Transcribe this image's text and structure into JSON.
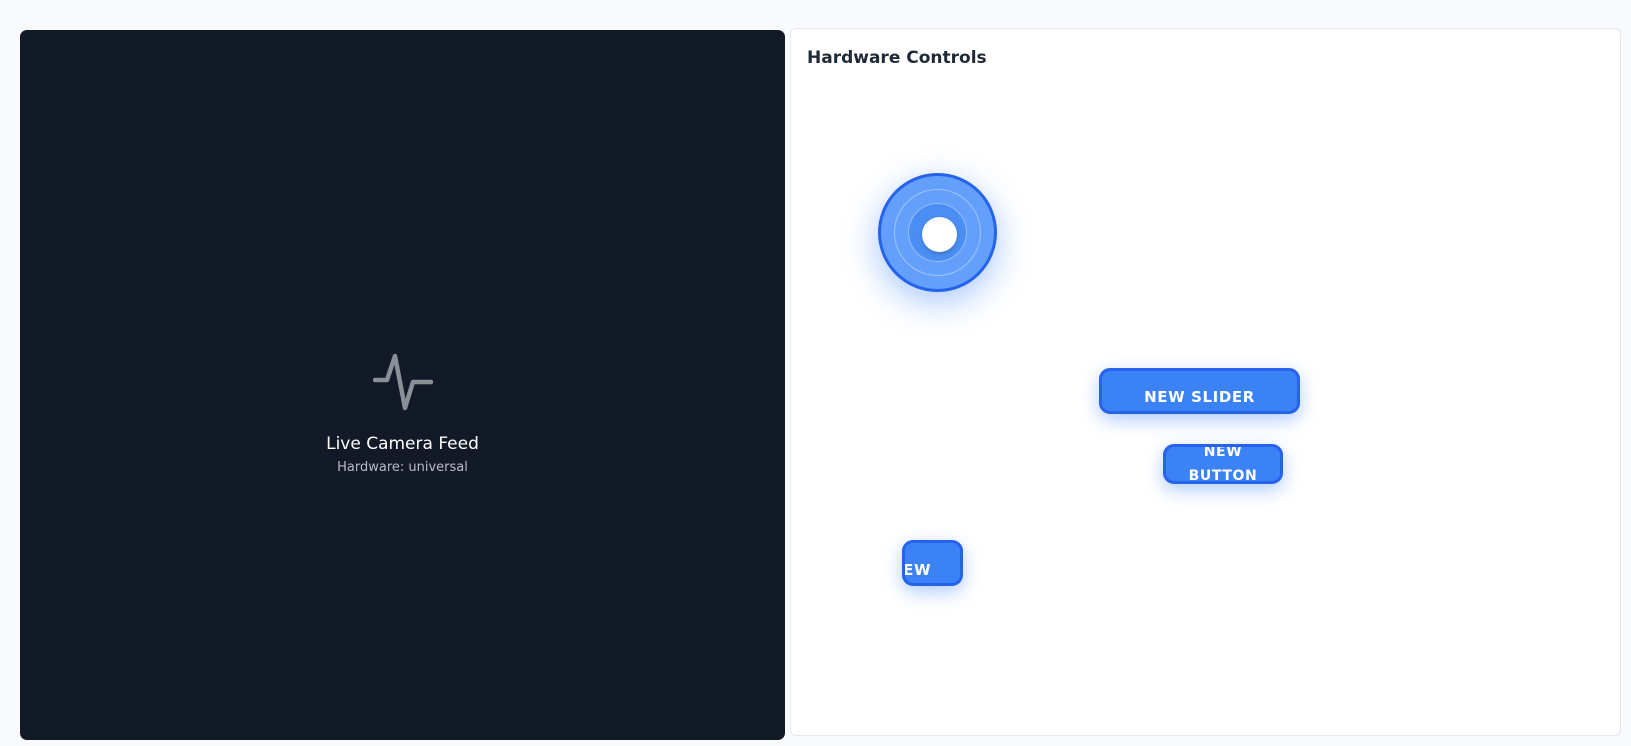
{
  "camera": {
    "icon": "pulse-icon",
    "title": "Live Camera Feed",
    "hardware_label": "Hardware: universal"
  },
  "controls": {
    "title": "Hardware Controls",
    "joystick": {
      "icon": "joystick"
    },
    "slider_button_label": "NEW SLIDER",
    "button_label": "NEW BUTTON",
    "small_button_label": "NEW"
  },
  "colors": {
    "page_bg": "#f8fafc",
    "camera_bg": "#121927",
    "accent": "#3b82f6",
    "accent_border": "#2563eb"
  }
}
